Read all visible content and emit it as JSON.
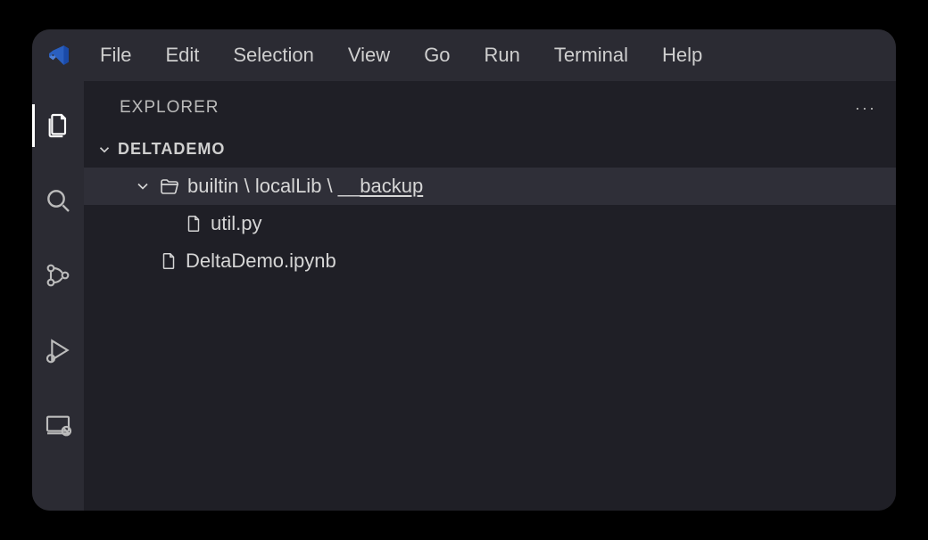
{
  "menu": {
    "file": "File",
    "edit": "Edit",
    "selection": "Selection",
    "view": "View",
    "go": "Go",
    "run": "Run",
    "terminal": "Terminal",
    "help": "Help"
  },
  "sidebar": {
    "title": "EXPLORER",
    "more": "···",
    "workspace": "DELTADEMO"
  },
  "tree": {
    "folder": {
      "seg1": "builtin",
      "sep1": " \\ ",
      "seg2": "localLib",
      "sep2": " \\ ",
      "seg3_pre": "__",
      "seg3_under": "backup"
    },
    "file1": "util.py",
    "file2": "DeltaDemo.ipynb"
  }
}
